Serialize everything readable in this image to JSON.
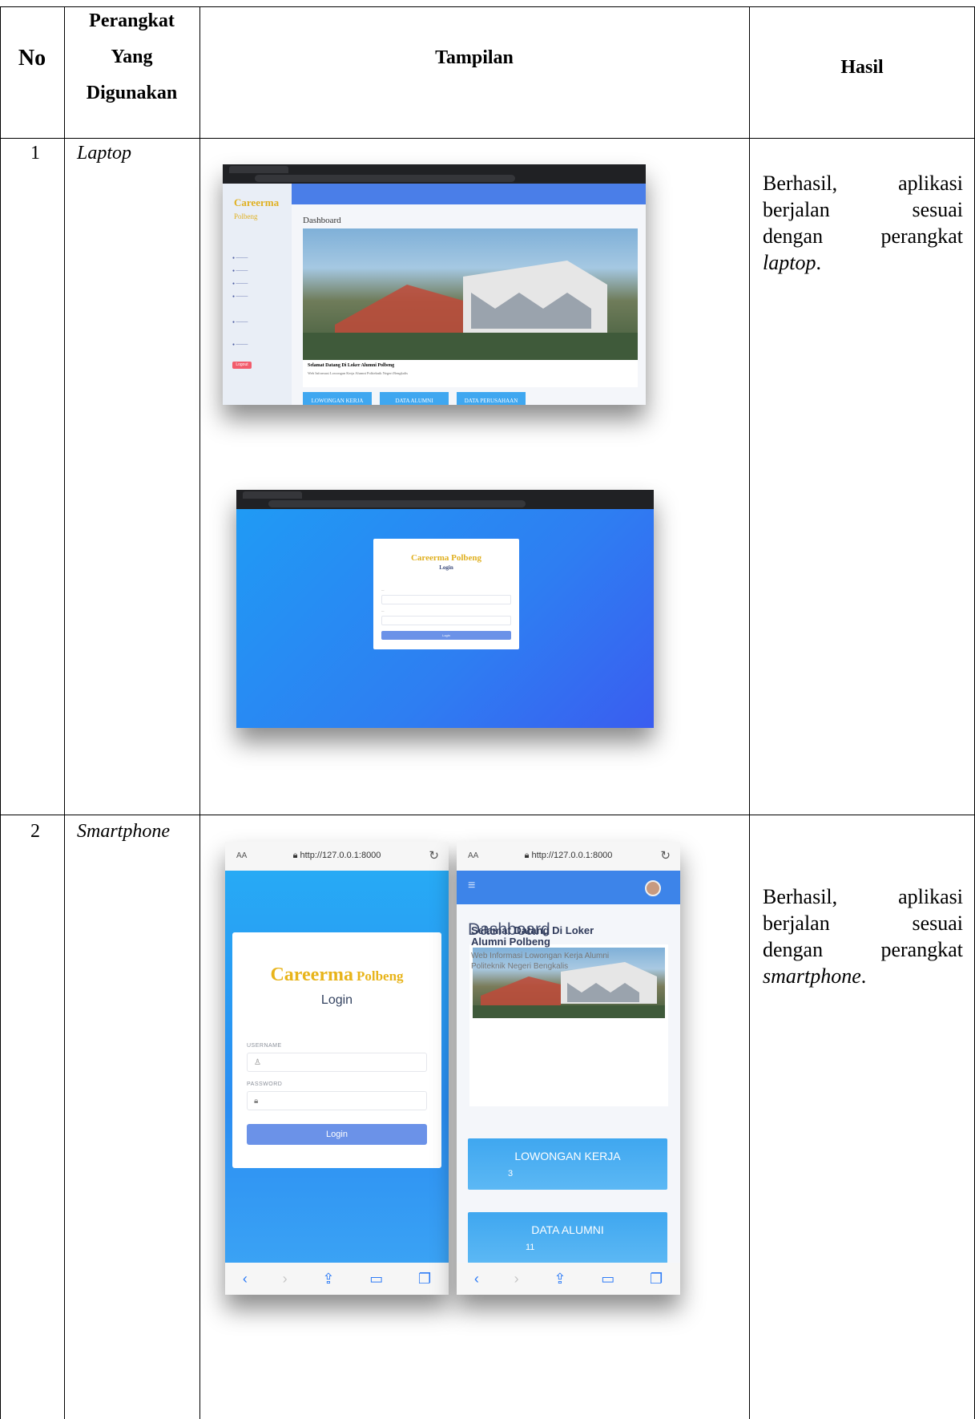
{
  "table": {
    "headers": {
      "no": "No",
      "perangkat_line1": "Perangkat",
      "perangkat_line2": "Yang",
      "perangkat_line3": "Digunakan",
      "tampilan": "Tampilan",
      "hasil": "Hasil"
    },
    "rows": [
      {
        "no": "1",
        "device": "Laptop",
        "result_words": [
          "Berhasil,",
          "aplikasi",
          "berjalan",
          "sesuai",
          "dengan",
          "perangkat"
        ],
        "result_device": "laptop",
        "result_end": "."
      },
      {
        "no": "2",
        "device": "Smartphone",
        "result_words": [
          "Berhasil,",
          "aplikasi",
          "berjalan",
          "sesuai",
          "dengan",
          "perangkat"
        ],
        "result_device": "smartphone",
        "result_end": "."
      }
    ]
  },
  "laptop_dashboard": {
    "brand_line1": "Careerma",
    "brand_line2": "Polbeng",
    "page_title": "Dashboard",
    "welcome_title": "Selamat Datang Di Loker Alumni Polbeng",
    "welcome_sub": "Web Informasi Lowongan Kerja Alumni Politeknik Negeri Bengkalis",
    "logout": "Logout",
    "buttons": [
      "LOWONGAN KERJA",
      "DATA ALUMNI",
      "DATA PERUSAHAAN"
    ]
  },
  "laptop_login": {
    "brand": "Careerma Polbeng",
    "title": "Login",
    "button": "Login"
  },
  "phone_login": {
    "aa": "AA",
    "url": "http://127.0.0.1:8000",
    "brand_big": "Careerma",
    "brand_small": "Polbeng",
    "title": "Login",
    "username_label": "USERNAME",
    "password_label": "PASSWORD",
    "button": "Login"
  },
  "phone_dashboard": {
    "aa": "AA",
    "url": "http://127.0.0.1:8000",
    "page_title": "Dashboard",
    "welcome_title": "Selamat Datang Di Loker Alumni Polbeng",
    "welcome_sub": "Web Informasi Lowongan Kerja Alumni Politeknik Negeri Bengkalis",
    "tiles": [
      {
        "label": "LOWONGAN KERJA",
        "value": "3"
      },
      {
        "label": "DATA ALUMNI",
        "value": "11"
      }
    ]
  }
}
